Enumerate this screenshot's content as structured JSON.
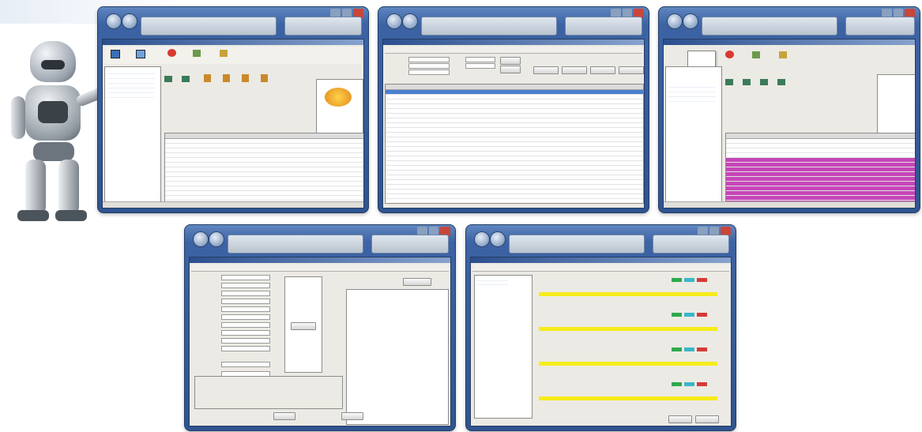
{
  "windows": [
    {
      "id": "w1",
      "kind": "tree-grid",
      "status": ""
    },
    {
      "id": "w2",
      "kind": "search-grid"
    },
    {
      "id": "w3",
      "kind": "tree-grid-highlight"
    },
    {
      "id": "w4",
      "kind": "form"
    },
    {
      "id": "w5",
      "kind": "schedule"
    }
  ],
  "colors": {
    "frame": "#3c63a4",
    "selection": "#4a7fd0",
    "highlight": "#c646b8",
    "schedule_bar": "#f6ec1a",
    "chip_green": "#2fa84f",
    "chip_cyan": "#39b7c9",
    "chip_red": "#d63a3a"
  },
  "icons": [
    "robot-mascot-icon",
    "back-icon",
    "forward-icon",
    "folder-icon",
    "monitor-icon"
  ]
}
